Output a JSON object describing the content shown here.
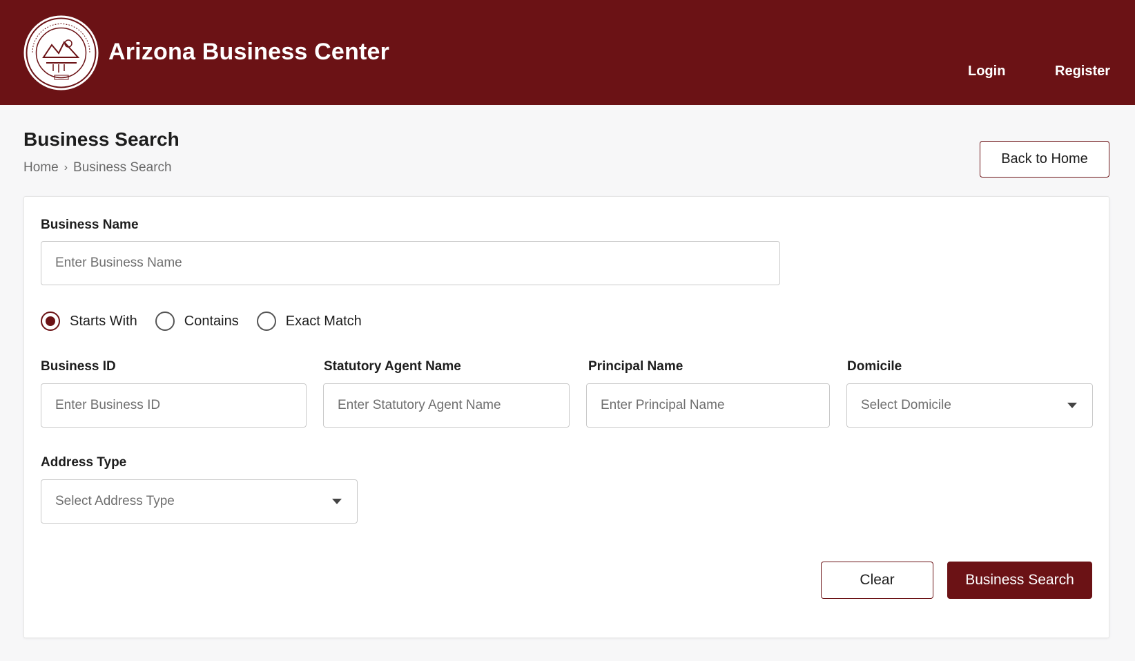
{
  "header": {
    "app_title": "Arizona Business Center",
    "seal_text": "THE GREAT SEAL OF THE STATE OF ARIZONA · DITAT DEUS · 1912",
    "nav": {
      "login": "Login",
      "register": "Register"
    },
    "bg_color": "#6b1215"
  },
  "page": {
    "title": "Business Search",
    "breadcrumb": {
      "home": "Home",
      "separator": "›",
      "current": "Business Search"
    },
    "back_button": "Back to Home"
  },
  "form": {
    "business_name": {
      "label": "Business Name",
      "placeholder": "Enter Business Name"
    },
    "match_options": [
      {
        "label": "Starts With",
        "checked": true
      },
      {
        "label": "Contains",
        "checked": false
      },
      {
        "label": "Exact Match",
        "checked": false
      }
    ],
    "business_id": {
      "label": "Business ID",
      "placeholder": "Enter Business ID"
    },
    "statutory_agent": {
      "label": "Statutory Agent Name",
      "placeholder": "Enter Statutory Agent Name"
    },
    "principal": {
      "label": "Principal Name",
      "placeholder": "Enter Principal Name"
    },
    "domicile": {
      "label": "Domicile",
      "selected": "Select Domicile"
    },
    "address_type": {
      "label": "Address Type",
      "selected": "Select Address Type"
    },
    "clear_button": "Clear",
    "search_button": "Business Search"
  },
  "colors": {
    "accent": "#6b1215",
    "page_bg": "#f7f7f8",
    "border": "#c9c9c9"
  }
}
